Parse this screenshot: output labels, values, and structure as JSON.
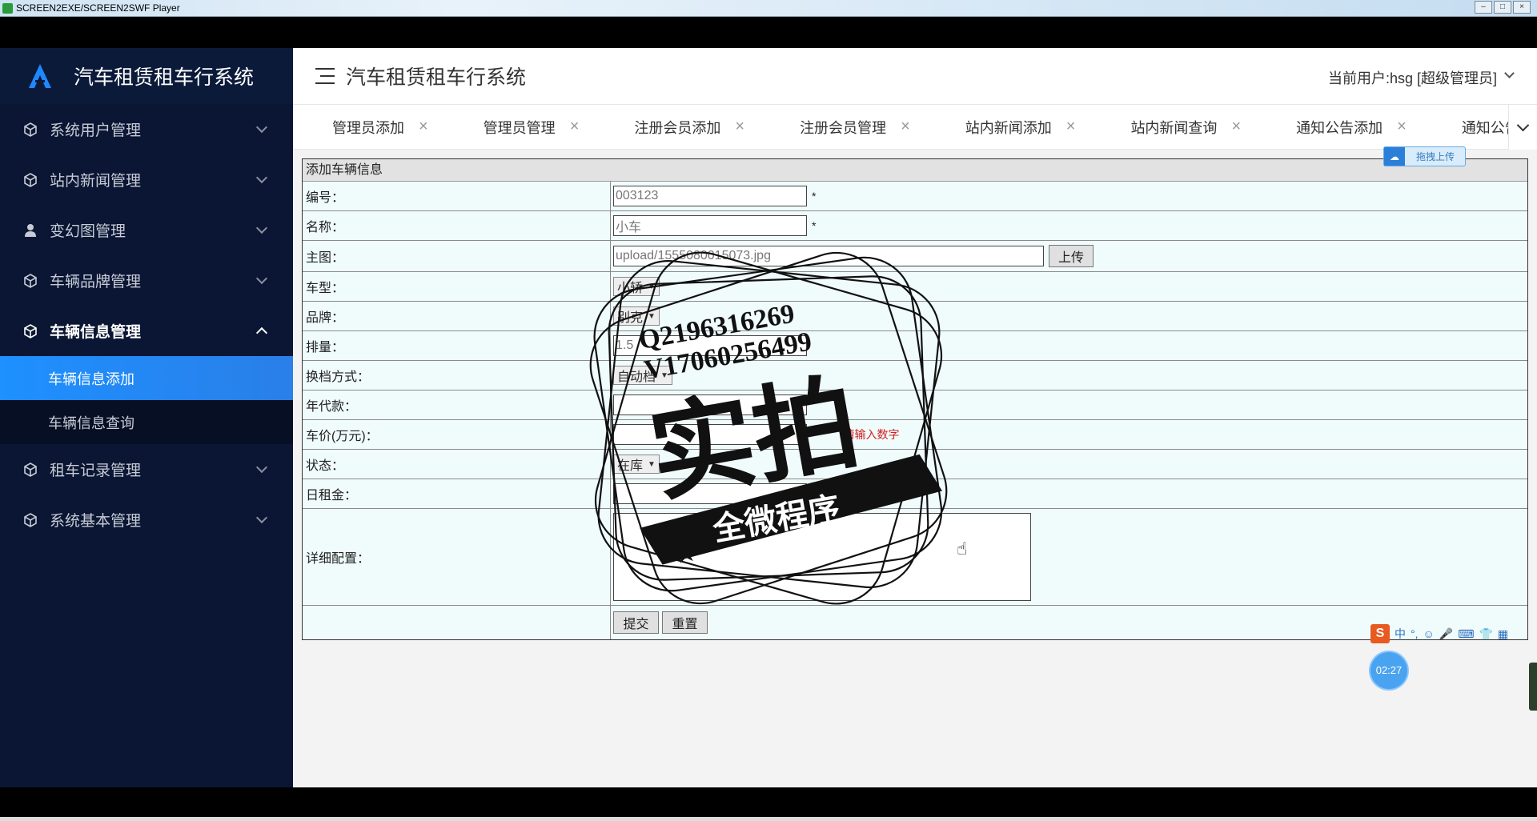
{
  "player": {
    "title": "SCREEN2EXE/SCREEN2SWF Player",
    "buttons": [
      "–",
      "□",
      "×"
    ]
  },
  "sidebar": {
    "brand": "汽车租赁租车行系统",
    "items": [
      {
        "label": "系统用户管理",
        "icon": "cube-icon"
      },
      {
        "label": "站内新闻管理",
        "icon": "cube-icon"
      },
      {
        "label": "变幻图管理",
        "icon": "user-icon"
      },
      {
        "label": "车辆品牌管理",
        "icon": "cube-icon"
      },
      {
        "label": "车辆信息管理",
        "icon": "cube-icon",
        "open": true,
        "children": [
          {
            "label": "车辆信息添加",
            "active": true
          },
          {
            "label": "车辆信息查询"
          }
        ]
      },
      {
        "label": "租车记录管理",
        "icon": "cube-icon"
      },
      {
        "label": "系统基本管理",
        "icon": "cube-icon"
      }
    ]
  },
  "header": {
    "title": "汽车租赁租车行系统",
    "user": "当前用户:hsg [超级管理员]"
  },
  "tabs": [
    {
      "label": "管理员添加",
      "close": "×"
    },
    {
      "label": "管理员管理",
      "close": "×"
    },
    {
      "label": "注册会员添加",
      "close": "×"
    },
    {
      "label": "注册会员管理",
      "close": "×"
    },
    {
      "label": "站内新闻添加",
      "close": "×"
    },
    {
      "label": "站内新闻查询",
      "close": "×"
    },
    {
      "label": "通知公告添加",
      "close": "×"
    },
    {
      "label": "通知公告查询"
    }
  ],
  "form": {
    "heading": "添加车辆信息",
    "required_mark": "*",
    "fields": {
      "bianhao": {
        "label": "编号：",
        "value": "003123"
      },
      "mingcheng": {
        "label": "名称：",
        "value": "小车"
      },
      "zhutu": {
        "label": "主图：",
        "value": "upload/1555080015073.jpg",
        "button": "上传"
      },
      "chexing": {
        "label": "车型：",
        "value": "小轿"
      },
      "pinpai": {
        "label": "品牌：",
        "value": "别克"
      },
      "pailiang": {
        "label": "排量：",
        "value": "1.5"
      },
      "huandang": {
        "label": "换档方式：",
        "value": "自动档"
      },
      "niandai": {
        "label": "年代款：",
        "value": ""
      },
      "chejia": {
        "label": "车价(万元)：",
        "value": "",
        "tip": "请输入数字"
      },
      "zhuangtai": {
        "label": "状态：",
        "value": "在库"
      },
      "rizujin": {
        "label": "日租金：",
        "value": ""
      },
      "peizhi": {
        "label": "详细配置：",
        "value": ""
      }
    },
    "submit": "提交",
    "reset": "重置"
  },
  "overlays": {
    "upload_badge": "拖拽上传",
    "ime_label": "中",
    "timer": "02:27",
    "watermark": {
      "line1": "Q2196316269",
      "line2": "V17060256499",
      "big": "实拍",
      "banner": "全微程序"
    }
  },
  "colors": {
    "sidebar_bg": "#0a1633",
    "active_item": "#1e90ff",
    "panel_bg": "#f0fbfb"
  }
}
